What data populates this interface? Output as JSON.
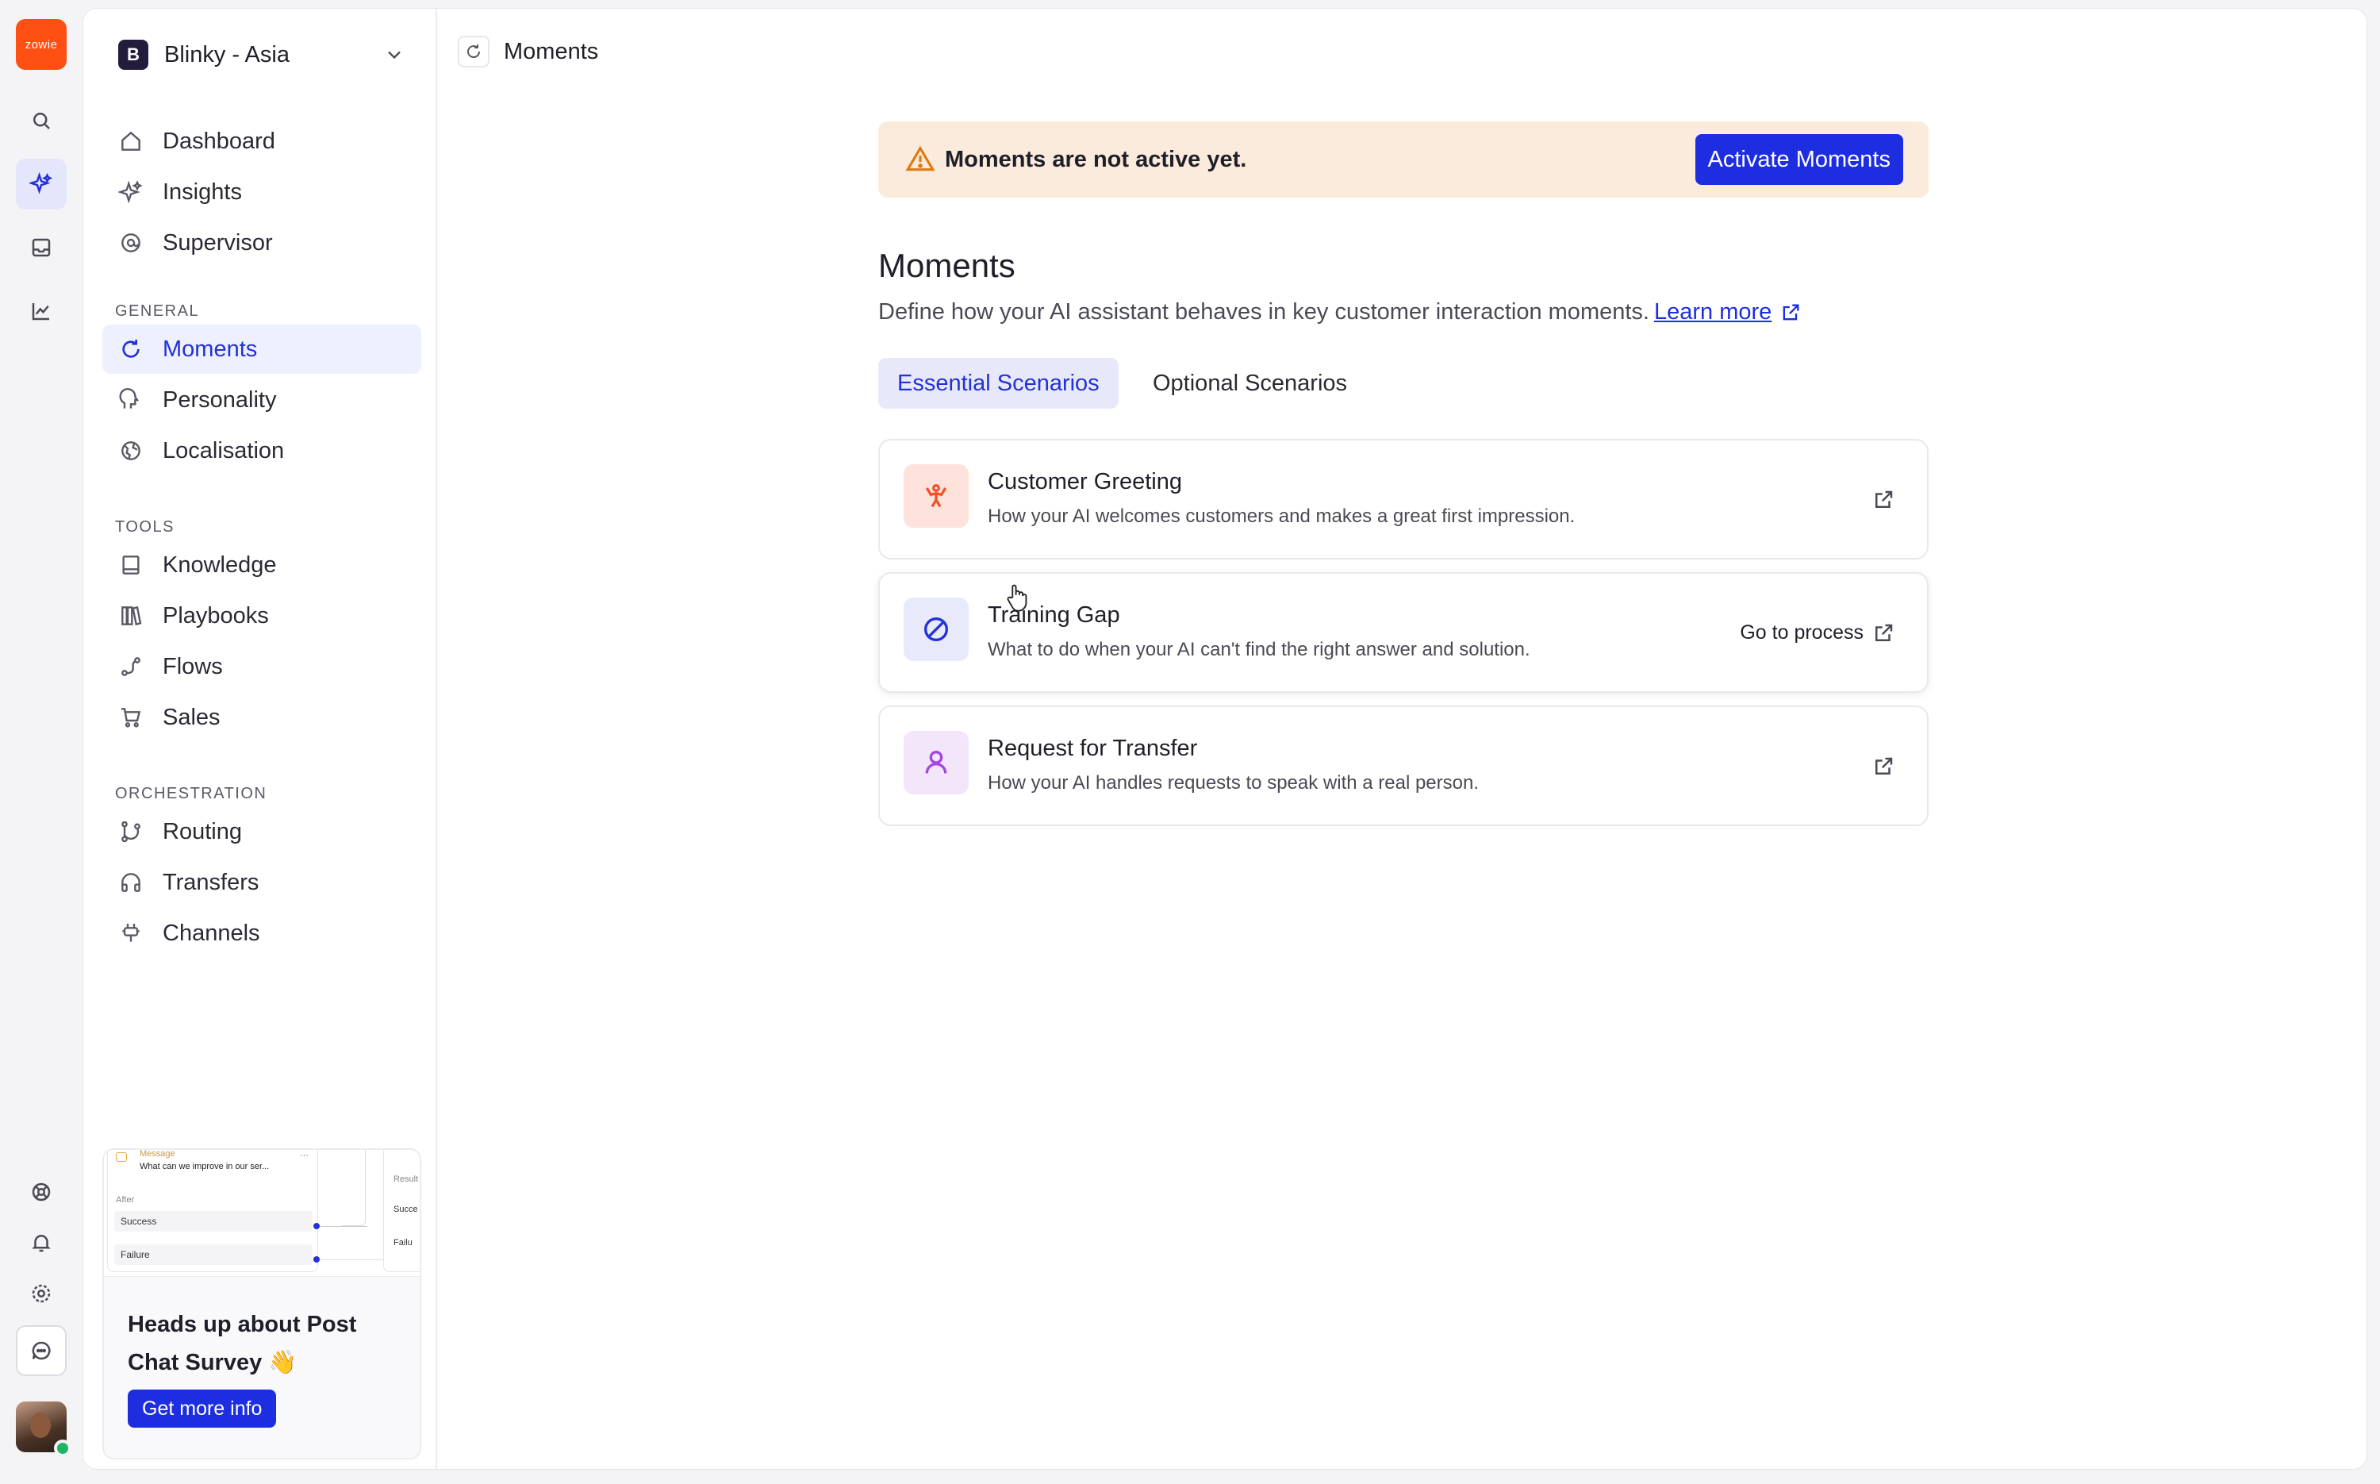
{
  "app": {
    "logo_text": "zowie"
  },
  "workspace": {
    "badge": "B",
    "name": "Blinky - Asia"
  },
  "sidebar": {
    "top_items": [
      {
        "label": "Dashboard",
        "icon": "home-icon"
      },
      {
        "label": "Insights",
        "icon": "sparkle-icon"
      },
      {
        "label": "Supervisor",
        "icon": "at-sign-icon"
      }
    ],
    "sections": [
      {
        "title": "GENERAL",
        "items": [
          {
            "label": "Moments",
            "icon": "refresh-icon",
            "active": true
          },
          {
            "label": "Personality",
            "icon": "speech-head-icon"
          },
          {
            "label": "Localisation",
            "icon": "globe-icon"
          }
        ]
      },
      {
        "title": "TOOLS",
        "items": [
          {
            "label": "Knowledge",
            "icon": "book-icon"
          },
          {
            "label": "Playbooks",
            "icon": "library-icon"
          },
          {
            "label": "Flows",
            "icon": "flow-icon"
          },
          {
            "label": "Sales",
            "icon": "cart-icon"
          }
        ]
      },
      {
        "title": "ORCHESTRATION",
        "items": [
          {
            "label": "Routing",
            "icon": "git-branch-icon"
          },
          {
            "label": "Transfers",
            "icon": "headset-icon"
          },
          {
            "label": "Channels",
            "icon": "plug-icon"
          }
        ]
      }
    ],
    "promo": {
      "preview": {
        "top": "Message",
        "question": "What can we improve in our ser...",
        "after": "After",
        "success": "Success",
        "failure": "Failure",
        "result": "Result",
        "res_success": "Succe",
        "res_failure": "Failu"
      },
      "title": "Heads up about Post Chat Survey 👋",
      "button": "Get more info"
    }
  },
  "breadcrumb": {
    "label": "Moments"
  },
  "banner": {
    "text": "Moments are not active yet.",
    "button": "Activate Moments",
    "color": "#fbebdc"
  },
  "page": {
    "title": "Moments",
    "description": "Define how your AI assistant behaves in key customer interaction moments.",
    "learn_more": "Learn more"
  },
  "tabs": [
    {
      "label": "Essential Scenarios",
      "active": true
    },
    {
      "label": "Optional Scenarios",
      "active": false
    }
  ],
  "cards": [
    {
      "title": "Customer Greeting",
      "description": "How your AI welcomes customers and makes a great first impression.",
      "icon": "greeting-person-icon",
      "icon_bg": "#fde3dc",
      "icon_color": "#f0522a"
    },
    {
      "title": "Training Gap",
      "description": "What to do when your AI can't find the right answer and solution.",
      "icon": "prohibited-icon",
      "icon_bg": "#e8eafc",
      "icon_color": "#2431d6",
      "action": "Go to process"
    },
    {
      "title": "Request for Transfer",
      "description": "How your AI handles requests to speak with a real person.",
      "icon": "person-icon",
      "icon_bg": "#f3e6fb",
      "icon_color": "#a445e0"
    }
  ]
}
